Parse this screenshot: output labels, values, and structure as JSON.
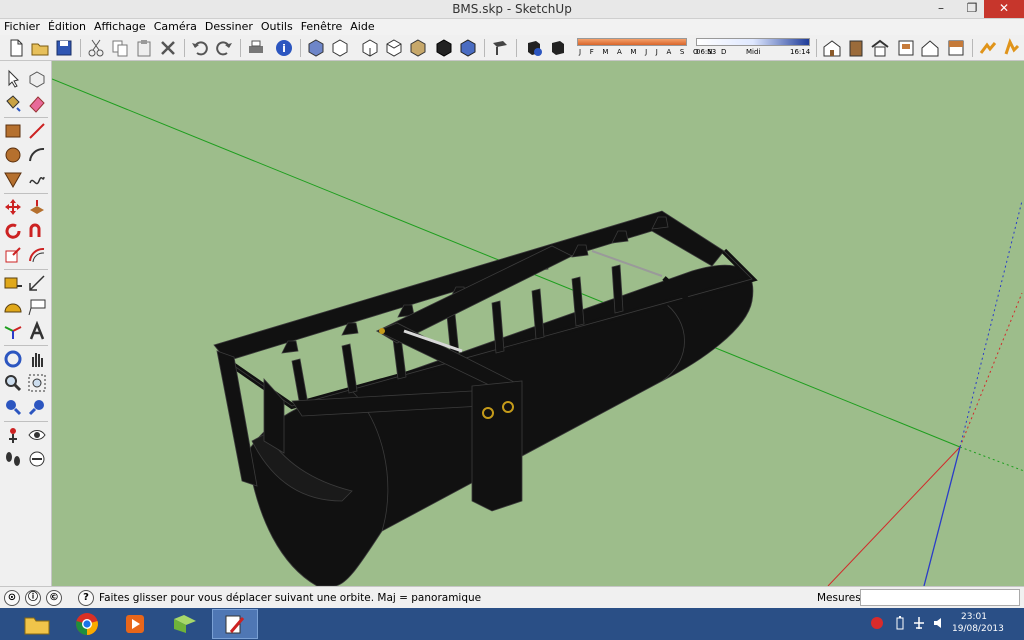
{
  "window": {
    "title": "BMS.skp - SketchUp",
    "minimize": "–",
    "restore": "❐",
    "close": "✕"
  },
  "menu": [
    "Fichier",
    "Édition",
    "Affichage",
    "Caméra",
    "Dessiner",
    "Outils",
    "Fenêtre",
    "Aide"
  ],
  "shadow_settings": {
    "months_label": "J F M A M J J A S O N D",
    "time_start": "06:53",
    "time_mid": "Midi",
    "time_end": "16:14"
  },
  "status": {
    "message": "Faites glisser pour vous déplacer suivant une orbite.  Maj = panoramique",
    "measurements_label": "Mesures",
    "measurements_value": ""
  },
  "taskbar": {
    "time": "23:01",
    "date": "19/08/2013"
  },
  "colors": {
    "viewport_bg": "#9dbd8b",
    "model": "#111111",
    "axis_red": "#d12b2b",
    "axis_green": "#1e9e1e",
    "axis_blue": "#2a3cc8",
    "taskbar": "#2a4f86"
  }
}
